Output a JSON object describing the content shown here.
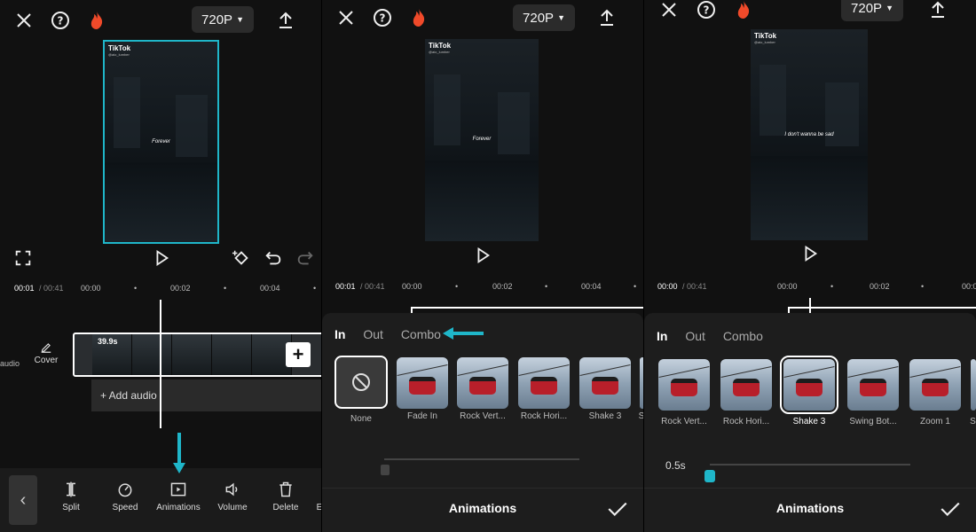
{
  "accent": "#1fb6c9",
  "resolution": "720P",
  "panel1": {
    "video": {
      "logo": "TikTok",
      "handle": "@aio_lumber",
      "caption": "Forever"
    },
    "time_current": "00:01",
    "time_total": "/ 00:41",
    "ticks": [
      "00:00",
      "00:02",
      "00:04"
    ],
    "audio_label": "audio",
    "cover_label": "Cover",
    "clip_duration": "39.9s",
    "add_audio": "+ Add audio",
    "tools": [
      "Split",
      "Speed",
      "Animations",
      "Volume",
      "Delete",
      "E"
    ]
  },
  "panel2": {
    "video": {
      "logo": "TikTok",
      "handle": "@aio_lumber",
      "caption": "Forever"
    },
    "time_current": "00:01",
    "time_total": "/ 00:41",
    "ticks": [
      "00:00",
      "00:02",
      "00:04"
    ],
    "tabs": [
      "In",
      "Out",
      "Combo"
    ],
    "thumbs": [
      "None",
      "Fade In",
      "Rock Vert...",
      "Rock Hori...",
      "Shake 3",
      "S"
    ],
    "footer_title": "Animations"
  },
  "panel3": {
    "video": {
      "logo": "TikTok",
      "handle": "@aio_lumber",
      "caption": "I don't wanna be sad"
    },
    "time_current": "00:00",
    "time_total": "/ 00:41",
    "ticks": [
      "00:00",
      "00:02",
      "00:0"
    ],
    "tabs": [
      "In",
      "Out",
      "Combo"
    ],
    "thumbs": [
      "Rock Vert...",
      "Rock Hori...",
      "Shake 3",
      "Swing Bot...",
      "Zoom 1",
      "S"
    ],
    "duration": "0.5s",
    "duration_fraction": 0.0,
    "footer_title": "Animations"
  }
}
